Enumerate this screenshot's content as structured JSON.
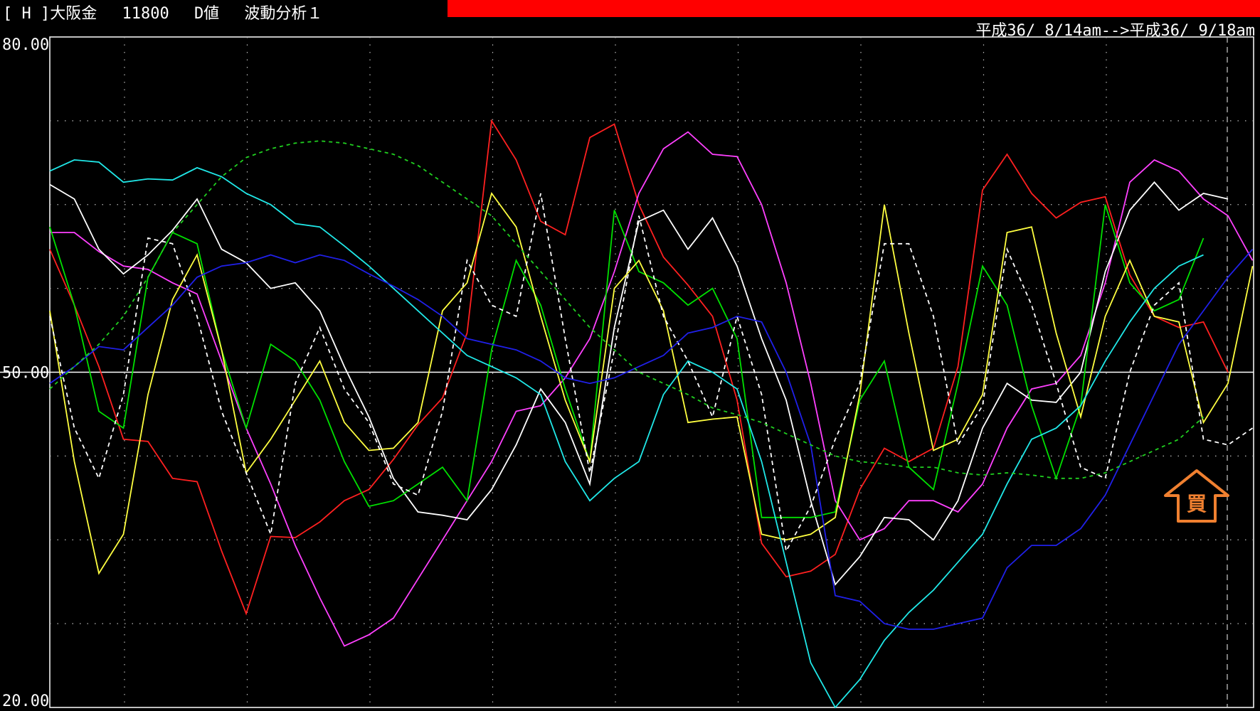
{
  "header": {
    "title": "[ H ]大阪金　 11800　 D値　 波動分析１",
    "date_range": "平成36/ 8/14am-->平成36/ 9/18am",
    "accent_color": "#ff0000"
  },
  "signal": {
    "label": "買",
    "icon": "up-arrow-icon",
    "color": "#f08030"
  },
  "chart_data": {
    "type": "line",
    "title": "",
    "xlabel": "",
    "ylabel": "",
    "ylim": [
      20,
      80
    ],
    "yticks": [
      "80.00",
      "50.00",
      "20.00"
    ],
    "x": [
      0,
      1,
      2,
      3,
      4,
      5,
      6,
      7,
      8,
      9,
      10,
      11,
      12,
      13,
      14,
      15,
      16,
      17,
      18,
      19,
      20,
      21,
      22,
      23,
      24,
      25,
      26,
      27,
      28,
      29,
      30,
      31,
      32,
      33,
      34,
      35,
      36,
      37,
      38,
      39,
      40,
      41,
      42,
      43,
      44,
      45,
      46,
      47,
      48,
      49,
      50
    ],
    "grid": true,
    "reference_line": 50,
    "series": [
      {
        "color": "#ff2020",
        "dash": "",
        "values": [
          61,
          56,
          50.5,
          44,
          43.8,
          40.5,
          40.2,
          34,
          28.4,
          35.3,
          35.2,
          36.6,
          38.5,
          39.5,
          42.2,
          45.3,
          47.7,
          53.5,
          72.5,
          69,
          63.5,
          62.3,
          71,
          72.2,
          65,
          60.3,
          57.8,
          55,
          47.5,
          34.7,
          31.7,
          32.2,
          33.7,
          39.5,
          43.2,
          42,
          43.2,
          50.5,
          66.3,
          69.5,
          66,
          63.8,
          65.2,
          65.7,
          58.7,
          55,
          54,
          54.5,
          50
        ]
      },
      {
        "color": "#ff40ff",
        "dash": "",
        "values": [
          62.5,
          62.5,
          60.8,
          59.5,
          59.2,
          58,
          57,
          51,
          45,
          40,
          34.5,
          29.8,
          25.5,
          26.5,
          28,
          31.5,
          35,
          38.5,
          42,
          46.5,
          47,
          49.5,
          53,
          59,
          66,
          70,
          71.5,
          69.5,
          69.3,
          65,
          58,
          49,
          38.5,
          35,
          36,
          38.5,
          38.5,
          37.5,
          40,
          45,
          48.5,
          49,
          51.5,
          58,
          67,
          69,
          68,
          65.5,
          64,
          60
        ]
      },
      {
        "color": "#ffffff",
        "dash": "",
        "values": [
          66.8,
          65.5,
          61,
          58.8,
          60.5,
          62.7,
          65.5,
          61,
          59.8,
          57.5,
          58,
          55.5,
          50.5,
          46,
          40.5,
          37.5,
          37.2,
          36.8,
          39.5,
          43.5,
          48.5,
          45.5,
          40,
          54,
          63.5,
          64.5,
          61,
          63.8,
          59.5,
          53,
          47.5,
          38.5,
          31,
          33.5,
          37,
          36.8,
          35,
          38.5,
          45,
          49,
          47.5,
          47.3,
          50,
          59,
          64.5,
          67,
          64.5,
          66,
          65.5
        ]
      },
      {
        "color": "#00e000",
        "dash": "",
        "values": [
          63,
          56,
          46.5,
          45,
          58.5,
          62.5,
          61.5,
          52,
          45,
          52.5,
          51,
          47.5,
          42,
          38,
          38.5,
          40,
          41.5,
          38.5,
          52,
          60,
          56,
          48.5,
          42,
          64.5,
          59,
          58,
          56,
          57.5,
          53,
          37,
          37,
          37,
          37.5,
          47.5,
          51,
          41.5,
          39.5,
          49,
          59.5,
          56,
          47,
          40.5,
          47,
          65,
          58,
          55.5,
          56.5,
          62
        ]
      },
      {
        "color": "#ffff40",
        "dash": "",
        "values": [
          55.5,
          42,
          32,
          35.5,
          48,
          56.5,
          60.5,
          52,
          41,
          44,
          47.5,
          51,
          45.5,
          43,
          43.2,
          45.5,
          55.5,
          58,
          66,
          63,
          55,
          47.5,
          42,
          57.5,
          60,
          55.5,
          45.5,
          45.8,
          46,
          35.5,
          35,
          35.5,
          37,
          48,
          65,
          53.5,
          43,
          44,
          48,
          62.5,
          63,
          53.5,
          46,
          55,
          60,
          55,
          54.5,
          45.5,
          49,
          59.5
        ]
      },
      {
        "color": "#ffffff",
        "dash": "6,5",
        "values": [
          55,
          45,
          40.5,
          48,
          62,
          61.5,
          55,
          46.5,
          41,
          35.5,
          49,
          54,
          48.5,
          45.5,
          40,
          39,
          46.5,
          60,
          56,
          55,
          66,
          53,
          41,
          52,
          64,
          55,
          51,
          46,
          55,
          48,
          34,
          38,
          44,
          49,
          61.5,
          61.5,
          55,
          43.5,
          47,
          61,
          56,
          49,
          41.5,
          40.5,
          50,
          56,
          58,
          44,
          43.5,
          45
        ]
      },
      {
        "color": "#20e8e8",
        "dash": "",
        "values": [
          68,
          69,
          68.8,
          67,
          67.3,
          67.2,
          68.3,
          67.5,
          66,
          65,
          63.3,
          63,
          61.3,
          59.5,
          57.5,
          55.5,
          53.5,
          51.5,
          50.5,
          49.5,
          48,
          42,
          38.5,
          40.5,
          42,
          48,
          51,
          50,
          48.5,
          42,
          33,
          24,
          20,
          22.5,
          26,
          28.5,
          30.5,
          33,
          35.5,
          40,
          44,
          45,
          47,
          51,
          54.5,
          57.5,
          59.5,
          60.5
        ]
      },
      {
        "color": "#2020e8",
        "dash": "",
        "values": [
          49,
          50.5,
          52.3,
          52,
          54,
          56,
          58.5,
          59.5,
          59.8,
          60.5,
          59.8,
          60.5,
          60,
          58.8,
          57.7,
          56.5,
          55,
          53,
          52.5,
          52,
          51,
          49.5,
          49,
          49.5,
          50.5,
          51.5,
          53.5,
          54,
          55,
          54.5,
          50,
          43.5,
          30,
          29.5,
          27.5,
          27,
          27,
          27.5,
          28,
          32.5,
          34.5,
          34.5,
          36,
          39,
          43.5,
          48,
          52.5,
          55.5,
          58.5,
          61
        ]
      },
      {
        "color": "#20d020",
        "dash": "5,5",
        "values": [
          48.5,
          50.5,
          52.5,
          55,
          58.5,
          62.5,
          65,
          67.5,
          69.2,
          70,
          70.5,
          70.7,
          70.5,
          70,
          69.5,
          68.5,
          67,
          65.5,
          64,
          61.5,
          59,
          56.5,
          54,
          52,
          50,
          49,
          48,
          46.8,
          46.2,
          45.5,
          44.5,
          43.5,
          42.5,
          42,
          41.8,
          41.5,
          41.5,
          41,
          40.8,
          41,
          40.8,
          40.5,
          40.5,
          41,
          42,
          43,
          44,
          46
        ]
      }
    ]
  }
}
